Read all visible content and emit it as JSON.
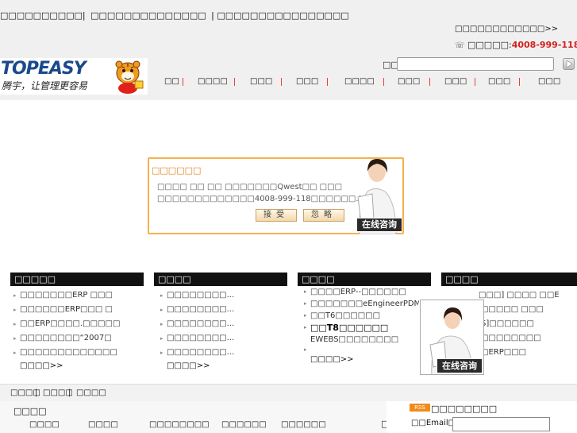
{
  "header": {
    "top_links": [
      "□□□□□□□□□□|",
      "□□□□□□□□□□□□□□",
      "| □□□□□□□□□□□□□□□□"
    ],
    "right_link": "□□□□□□□□□□□□>>",
    "hotline_label": "□□□□□:",
    "hotline_number": "4008-999-118",
    "logo_text": "TOPEASY",
    "logo_slogan": "腾宇，让管理更容易",
    "search_label": "□□",
    "search_placeholder": ""
  },
  "nav": {
    "items": [
      "□□",
      "□□□□",
      "□□□",
      "□□□",
      "□□□□",
      "□□□",
      "□□□",
      "□□□",
      "□□□"
    ]
  },
  "popup": {
    "title": "□□□□□□",
    "line1": "□□□□ □□ □□ □□□□□□□Qwest□□ □□□",
    "line2": "□□□□□□□□□□□□□4008-999-118□□□□□□.□□!",
    "accept_label": "接受",
    "ignore_label": "忽略",
    "consult_label": "在线咨询"
  },
  "columns": [
    {
      "title": "□□□□□",
      "items": [
        "□□□□□□□ERP □□□",
        "□□□□□□ERP□□□ □",
        "□□ERP□□□□.□□□□□",
        "□□□□□□□□“2007□",
        "□□□□□□□□□□□□□"
      ],
      "more": "□□□□>>"
    },
    {
      "title": "□□□□",
      "items": [
        "□□□□□□□□...",
        "□□□□□□□□...",
        "□□□□□□□□...",
        "□□□□□□□□...",
        "□□□□□□□□..."
      ],
      "more": "□□□□>>"
    },
    {
      "title": "□□□□",
      "items": [
        "□□□□ERP--□□□□□□",
        "□□□□□□□eEngineerPDM",
        "□□T6□□□□□□",
        "□□T8□□□□□□",
        "EWEBS□□□□□□□□"
      ],
      "more": "□□□□>>"
    },
    {
      "title": "□□□□",
      "items": [
        "□□□] □□□□ □□E",
        "□□□□□ □□□",
        "S]□□□□□□",
        "□□□□□□□□",
        "□ERP□□□"
      ],
      "more": ""
    }
  ],
  "float_consult_label": "在线咨询",
  "footer_links": [
    "□□□□",
    "□□□□",
    "□□□□"
  ],
  "bottom": {
    "title": "□□□□",
    "links": [
      "□□□□",
      "□□□□",
      "□□□□□□□□",
      "□□□□□□",
      "□□□□□□"
    ],
    "cut_mark": "□",
    "rss_badge": "RSS",
    "rss_text": "□□□□□□□□",
    "email_label": "□□Email□"
  },
  "colors": {
    "accent_orange": "#e27c10",
    "hotline_red": "#d42020",
    "header_black": "#111111",
    "nav_separator": "#e04040"
  }
}
